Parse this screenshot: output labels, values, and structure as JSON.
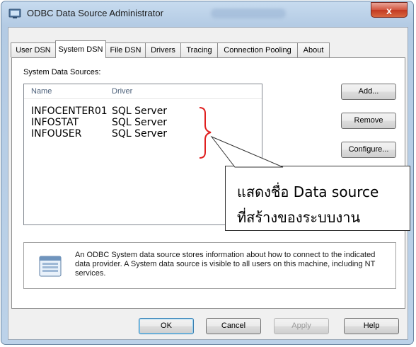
{
  "window": {
    "title": "ODBC Data Source Administrator",
    "close_glyph": "x"
  },
  "tabs": [
    {
      "label": "User DSN",
      "active": false
    },
    {
      "label": "System DSN",
      "active": true
    },
    {
      "label": "File DSN",
      "active": false
    },
    {
      "label": "Drivers",
      "active": false
    },
    {
      "label": "Tracing",
      "active": false
    },
    {
      "label": "Connection Pooling",
      "active": false
    },
    {
      "label": "About",
      "active": false
    }
  ],
  "system_dsn": {
    "section_label": "System Data Sources:",
    "columns": {
      "name": "Name",
      "driver": "Driver"
    },
    "rows": [
      {
        "name": "INFOCENTER01",
        "driver": "SQL Server"
      },
      {
        "name": "INFOSTAT",
        "driver": "SQL Server"
      },
      {
        "name": "INFOUSER",
        "driver": "SQL Server"
      }
    ],
    "buttons": {
      "add": "Add...",
      "remove": "Remove",
      "configure": "Configure..."
    },
    "info_text": "An ODBC System data source stores information about how to connect to the indicated data provider.   A System data source is visible to all users on this machine, including NT services."
  },
  "footer": {
    "ok": "OK",
    "cancel": "Cancel",
    "apply": "Apply",
    "help": "Help"
  },
  "annotation": {
    "line1": "แสดงชื่อ Data source",
    "line2": "ที่สร้างของระบบงาน",
    "brace_color": "#e02020"
  },
  "colors": {
    "accent": "#3c7fb1",
    "close": "#c33a22"
  }
}
